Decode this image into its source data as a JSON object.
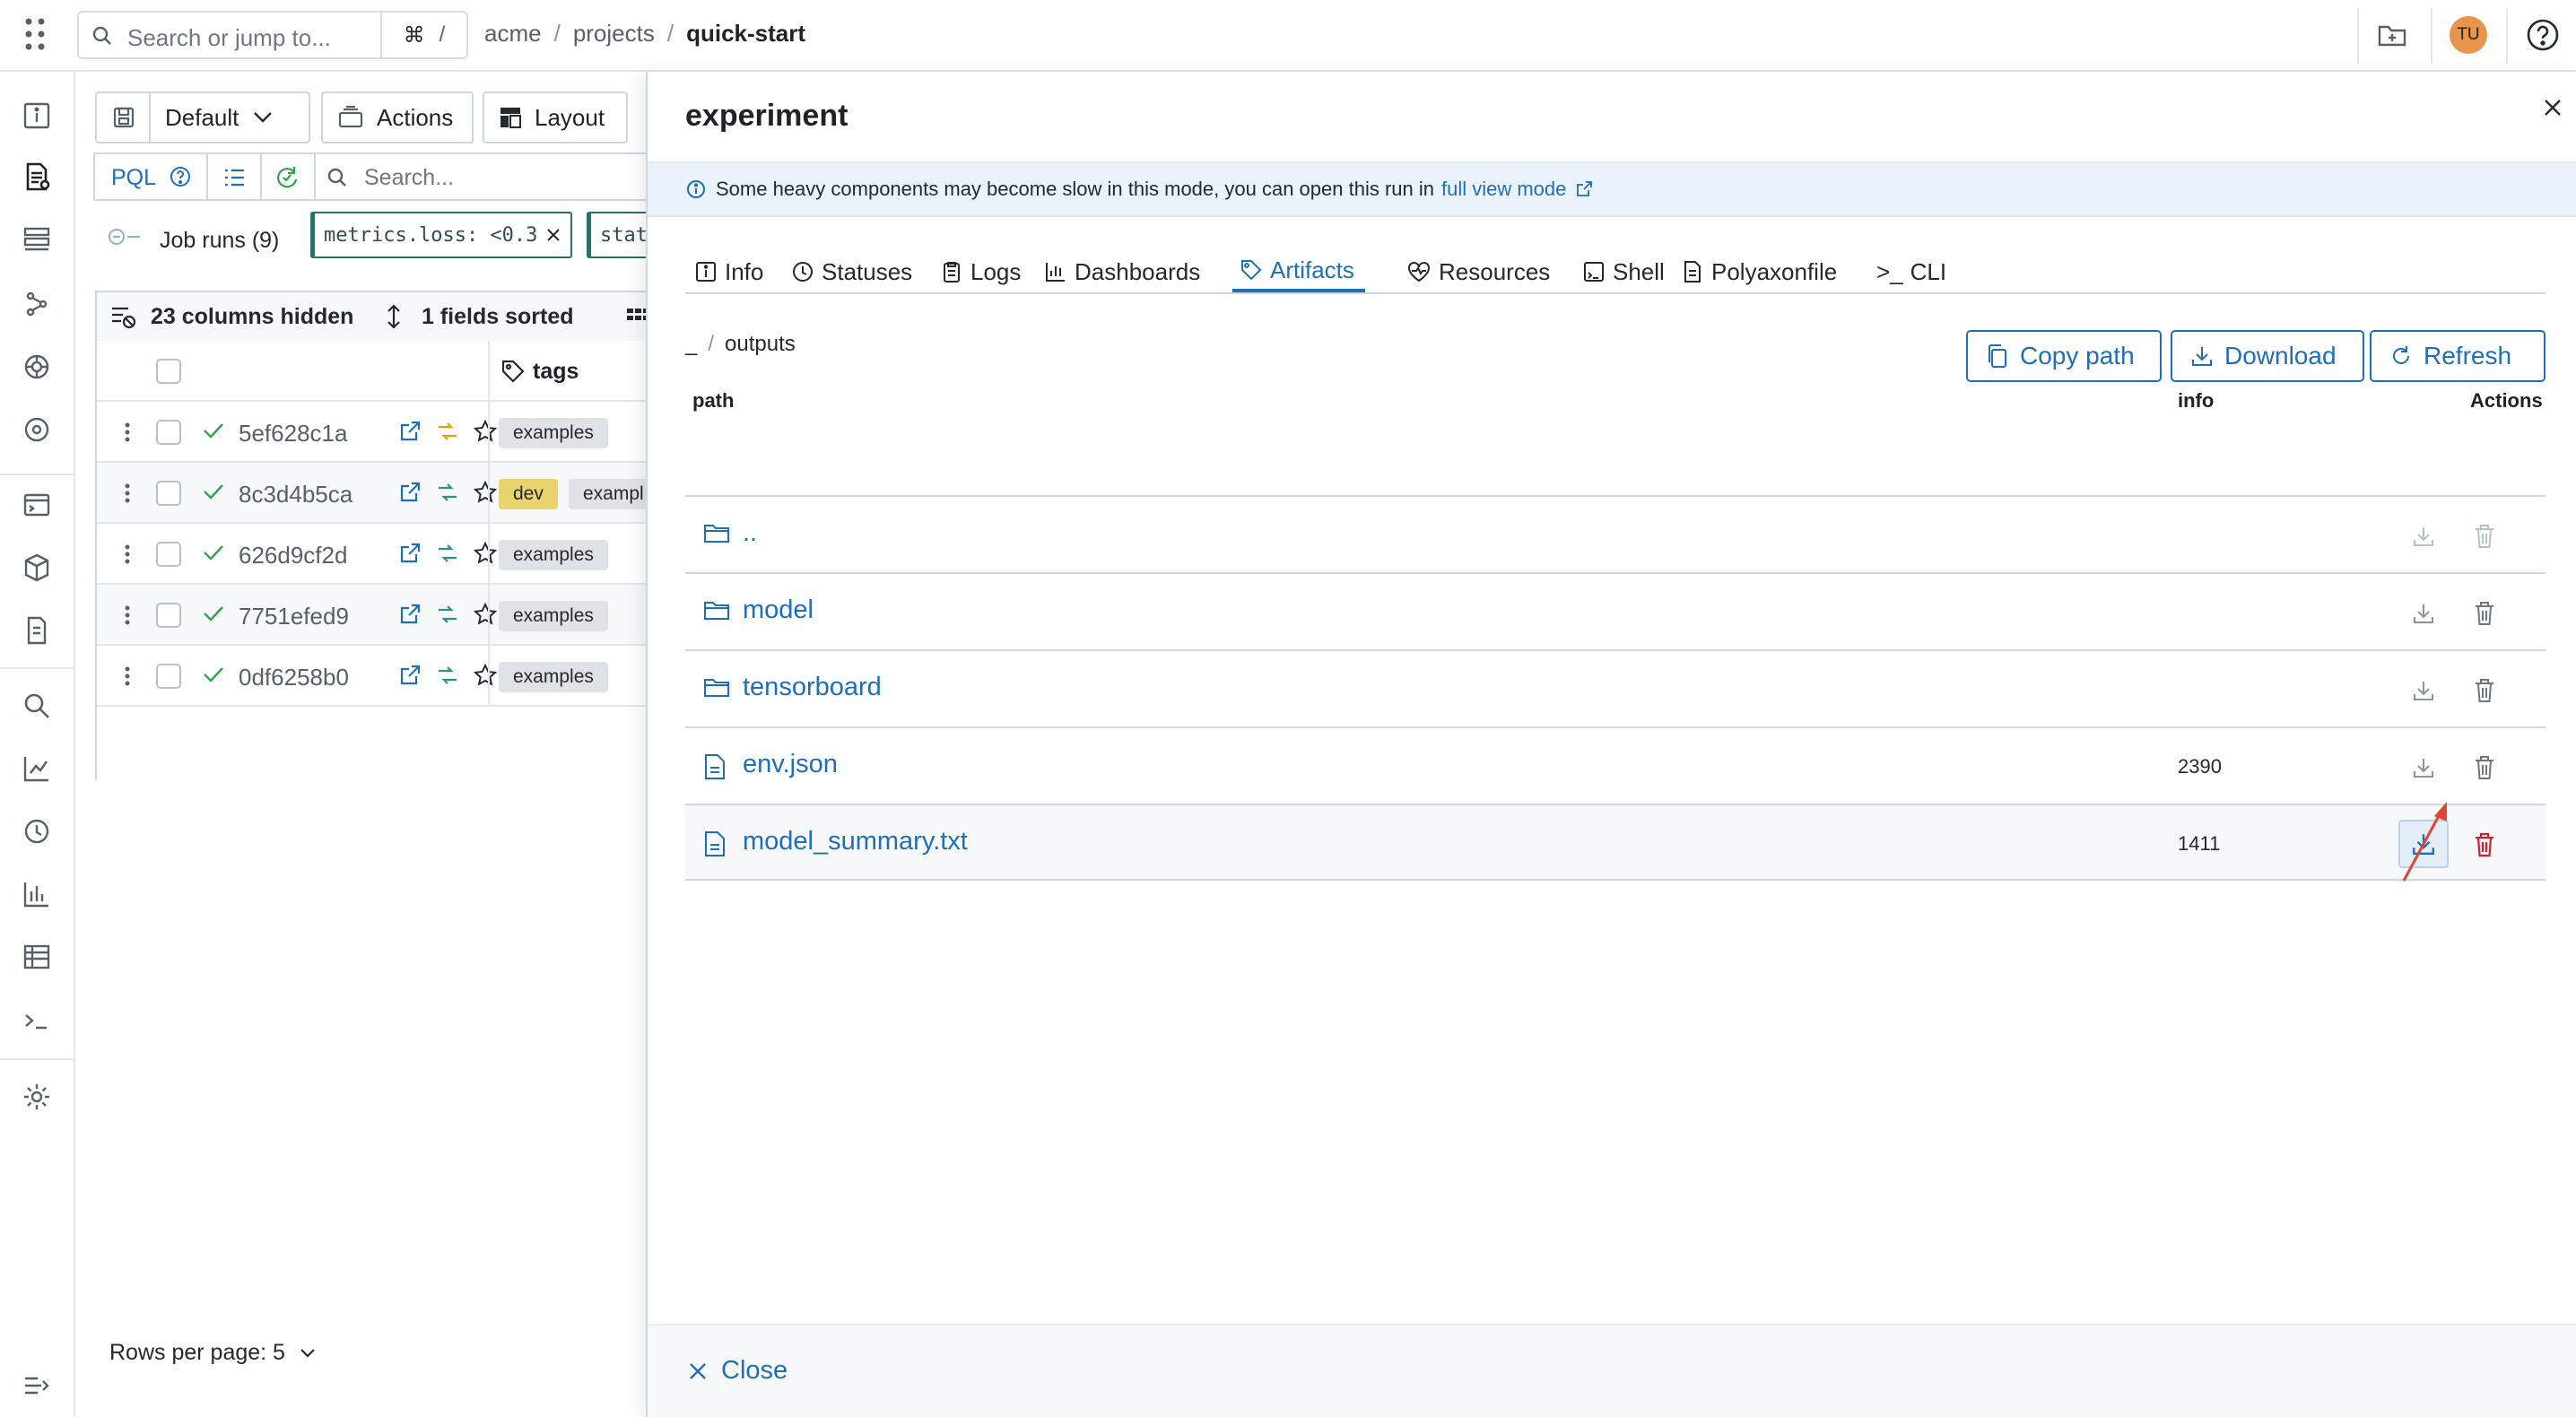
{
  "topbar": {
    "search_placeholder": "Search or jump to...",
    "shortcut_cmd": "⌘",
    "shortcut_key": "/",
    "breadcrumb": [
      "acme",
      "projects",
      "quick-start"
    ],
    "breadcrumb_sep": "/",
    "avatar_initials": "TU"
  },
  "toolbar": {
    "default_label": "Default",
    "actions_label": "Actions",
    "layout_label": "Layout",
    "pql_label": "PQL",
    "search_placeholder": "Search..."
  },
  "runs": {
    "group_label": "Job runs (9)",
    "chip_filter": "metrics.loss: <0.3",
    "chip_partial": "stat",
    "columns_hidden": "23 columns hidden",
    "fields_sorted": "1 fields sorted",
    "tags_header": "tags",
    "rows": [
      {
        "id": "5ef628c1a",
        "tags": [
          "examples"
        ]
      },
      {
        "id": "8c3d4b5ca",
        "tags": [
          "dev",
          "exampl"
        ]
      },
      {
        "id": "626d9cf2d",
        "tags": [
          "examples"
        ]
      },
      {
        "id": "7751efed9",
        "tags": [
          "examples"
        ]
      },
      {
        "id": "0df6258b0",
        "tags": [
          "examples"
        ]
      }
    ],
    "rows_per_page": "Rows per page: 5"
  },
  "drawer": {
    "title": "experiment",
    "notice_text": "Some heavy components may become slow in this mode, you can open this run in",
    "notice_link": "full view mode",
    "tabs": [
      "Info",
      "Statuses",
      "Logs",
      "Dashboards",
      "Artifacts",
      "Resources",
      "Shell",
      "Polyaxonfile",
      "CLI"
    ],
    "active_tab": "Artifacts",
    "cli_prefix": ">_",
    "path_root": "_",
    "path_sep": "/",
    "path_current": "outputs",
    "copy_path_label": "Copy path",
    "download_label": "Download",
    "refresh_label": "Refresh",
    "col_path": "path",
    "col_info": "info",
    "col_actions": "Actions",
    "files": [
      {
        "name": "..",
        "type": "folder",
        "info": ""
      },
      {
        "name": "model",
        "type": "folder",
        "info": ""
      },
      {
        "name": "tensorboard",
        "type": "folder",
        "info": ""
      },
      {
        "name": "env.json",
        "type": "file",
        "info": "2390"
      },
      {
        "name": "model_summary.txt",
        "type": "file",
        "info": "1411"
      }
    ],
    "close_label": "Close"
  },
  "colors": {
    "accent": "#1f6fb8",
    "success": "#2da44e",
    "danger": "#cf222e",
    "notice_bg": "#eaf2fb",
    "annotation_arrow": "#e0452f"
  }
}
